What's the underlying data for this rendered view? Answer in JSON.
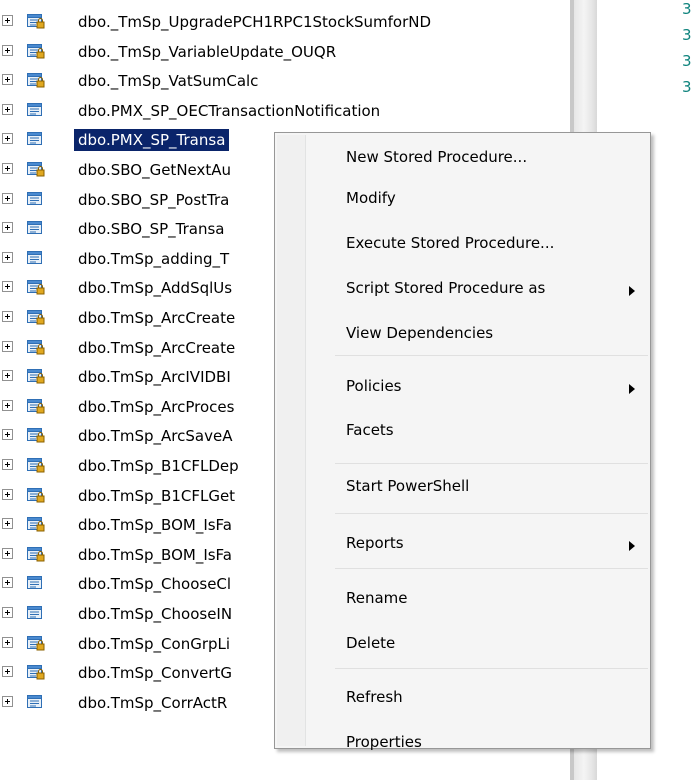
{
  "tree": {
    "rows": [
      {
        "label": "dbo._TmSp_UpgradePCH1RPC1StockSumforND",
        "locked": true
      },
      {
        "label": "dbo._TmSp_VariableUpdate_OUQR",
        "locked": true
      },
      {
        "label": "dbo._TmSp_VatSumCalc",
        "locked": true
      },
      {
        "label": "dbo.PMX_SP_OECTransactionNotification",
        "locked": false
      },
      {
        "label": "dbo.PMX_SP_Transa",
        "locked": false,
        "selected": true
      },
      {
        "label": "dbo.SBO_GetNextAu",
        "locked": true
      },
      {
        "label": "dbo.SBO_SP_PostTra",
        "locked": false
      },
      {
        "label": "dbo.SBO_SP_Transa",
        "locked": false
      },
      {
        "label": "dbo.TmSp_adding_T",
        "locked": false
      },
      {
        "label": "dbo.TmSp_AddSqlUs",
        "locked": true
      },
      {
        "label": "dbo.TmSp_ArcCreate",
        "locked": true
      },
      {
        "label": "dbo.TmSp_ArcCreate",
        "locked": true
      },
      {
        "label": "dbo.TmSp_ArcIVIDBI",
        "locked": true
      },
      {
        "label": "dbo.TmSp_ArcProces",
        "locked": true
      },
      {
        "label": "dbo.TmSp_ArcSaveA",
        "locked": true
      },
      {
        "label": "dbo.TmSp_B1CFLDep",
        "locked": true
      },
      {
        "label": "dbo.TmSp_B1CFLGet",
        "locked": true
      },
      {
        "label": "dbo.TmSp_BOM_IsFa",
        "locked": true
      },
      {
        "label": "dbo.TmSp_BOM_IsFa",
        "locked": true
      },
      {
        "label": "dbo.TmSp_ChooseCl",
        "locked": false
      },
      {
        "label": "dbo.TmSp_ChooseIN",
        "locked": false
      },
      {
        "label": "dbo.TmSp_ConGrpLi",
        "locked": true
      },
      {
        "label": "dbo.TmSp_ConvertG",
        "locked": true
      },
      {
        "label": "dbo.TmSp_CorrActR",
        "locked": false
      }
    ]
  },
  "side_column": [
    "3",
    "3",
    "3",
    "3"
  ],
  "context_menu": {
    "items": [
      {
        "label": "New Stored Procedure...",
        "submenu": false
      },
      {
        "label": "Modify",
        "submenu": false
      },
      {
        "label": "Execute Stored Procedure...",
        "submenu": false
      },
      {
        "label": "Script Stored Procedure as",
        "submenu": true
      },
      {
        "label": "View Dependencies",
        "submenu": false
      },
      {
        "label": "Policies",
        "submenu": true
      },
      {
        "label": "Facets",
        "submenu": false
      },
      {
        "label": "Start PowerShell",
        "submenu": false
      },
      {
        "label": "Reports",
        "submenu": true
      },
      {
        "label": "Rename",
        "submenu": false
      },
      {
        "label": "Delete",
        "submenu": false
      },
      {
        "label": "Refresh",
        "submenu": false
      },
      {
        "label": "Properties",
        "submenu": false
      }
    ]
  },
  "colors": {
    "selection": "#0a246a",
    "side_text": "#10847e",
    "menu_bg": "#f5f5f5"
  },
  "icons": {
    "expander": "plus-box-icon",
    "procedure": "stored-procedure-icon",
    "lock": "lock-icon",
    "submenu": "submenu-arrow-icon"
  }
}
